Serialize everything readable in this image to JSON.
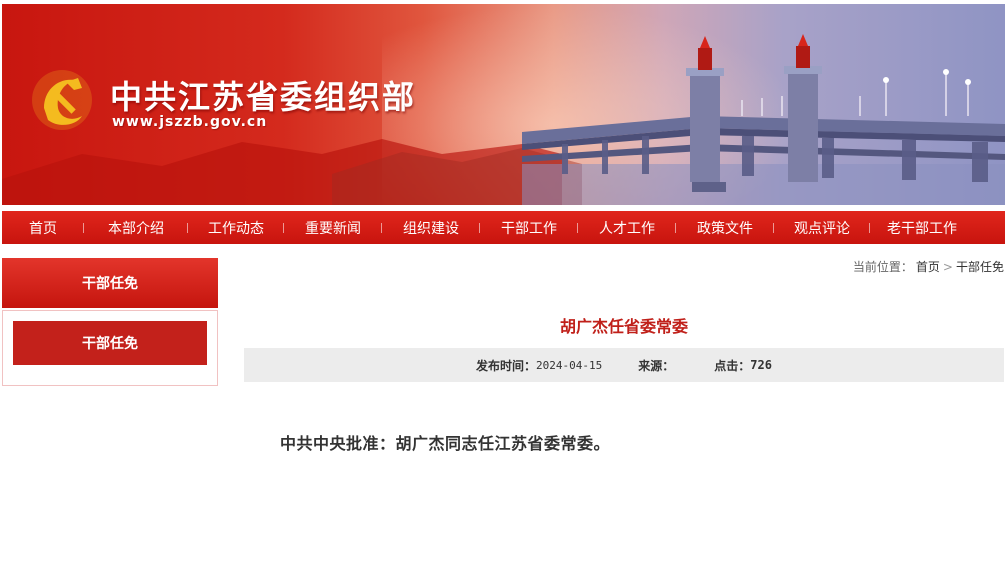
{
  "site": {
    "title": "中共江苏省委组织部",
    "url": "www.jszzb.gov.cn"
  },
  "nav": {
    "items": [
      "首页",
      "本部介绍",
      "工作动态",
      "重要新闻",
      "组织建设",
      "干部工作",
      "人才工作",
      "政策文件",
      "观点评论",
      "老干部工作"
    ]
  },
  "sidebar": {
    "header": "干部任免",
    "items": [
      "干部任免"
    ]
  },
  "breadcrumb": {
    "prefix": "当前位置：",
    "home": "首页",
    "separator": ">",
    "current": "干部任免"
  },
  "article": {
    "title": "胡广杰任省委常委",
    "publish_label": "发布时间：",
    "publish_date": "2024-04-15",
    "source_label": "来源：",
    "source_value": "",
    "clicks_label": "点击：",
    "clicks": "726",
    "body": "中共中央批准：胡广杰同志任江苏省委常委。"
  },
  "colors": {
    "primary_red": "#c8140e",
    "title_red": "#c0201a",
    "meta_bg": "#ececec"
  }
}
